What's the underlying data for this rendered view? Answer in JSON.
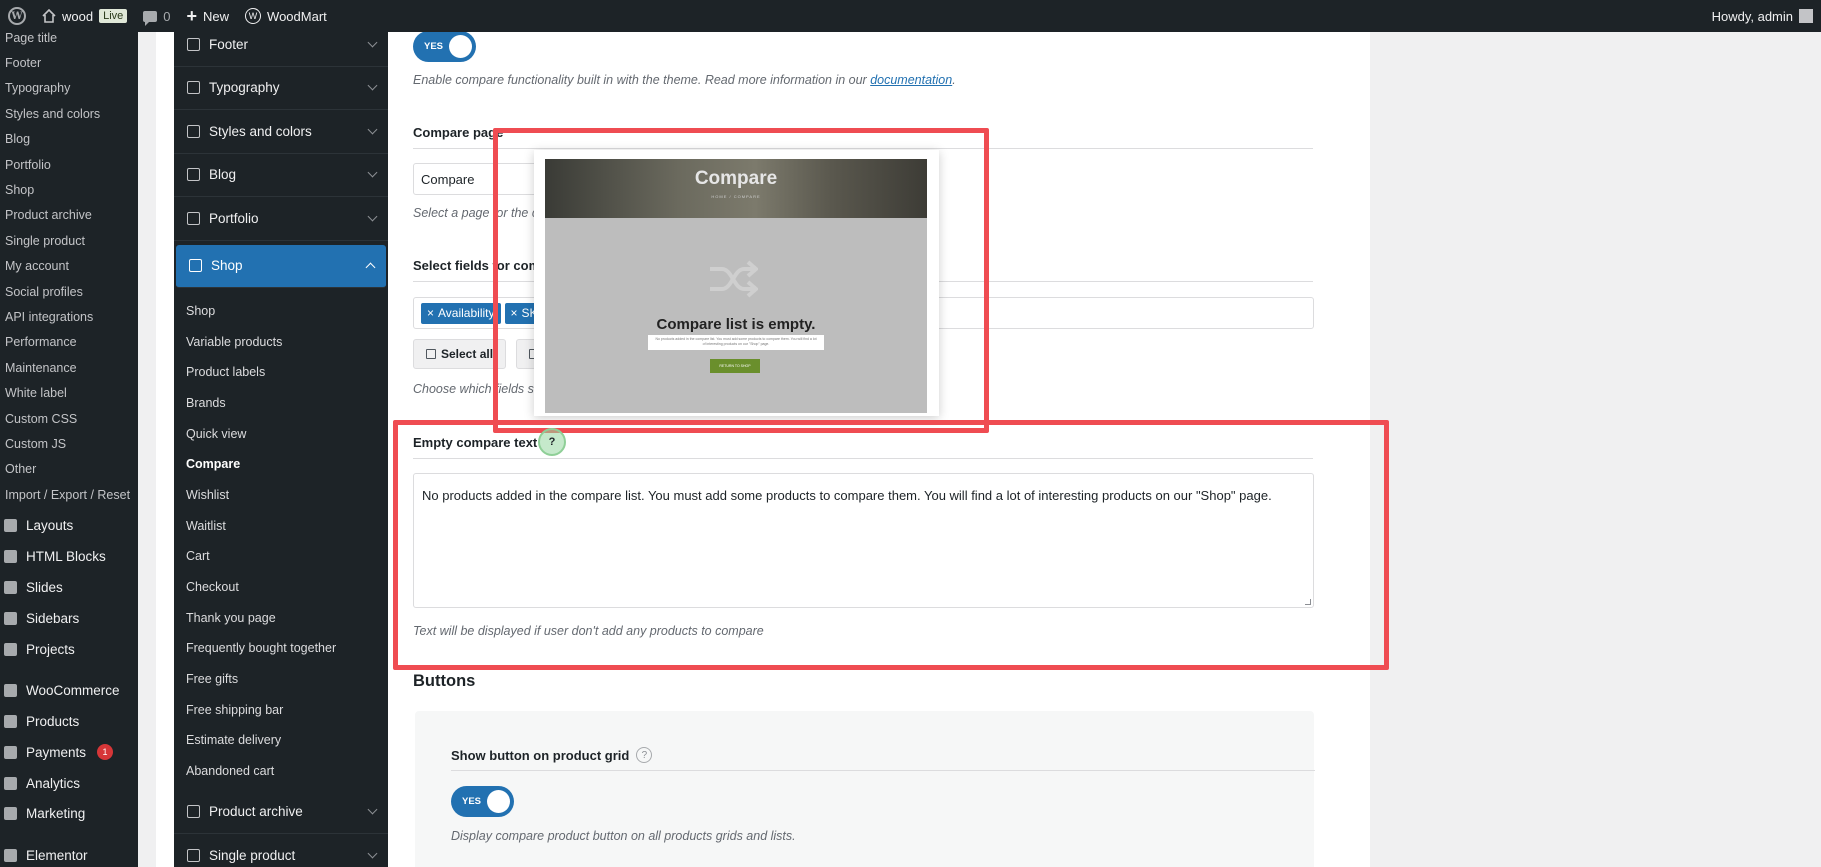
{
  "admin_bar": {
    "site_name": "wood",
    "live_badge": "Live",
    "comments_count": "0",
    "new_label": "New",
    "theme_label": "WoodMart",
    "greeting": "Howdy, admin"
  },
  "admin_menu": {
    "sub_items": [
      "Page title",
      "Footer",
      "Typography",
      "Styles and colors",
      "Blog",
      "Portfolio",
      "Shop",
      "Product archive",
      "Single product",
      "My account",
      "Social profiles",
      "API integrations",
      "Performance",
      "Maintenance",
      "White label",
      "Custom CSS",
      "Custom JS",
      "Other",
      "Import / Export / Reset"
    ],
    "main_items": [
      {
        "label": "Layouts",
        "icon": "layouts-icon"
      },
      {
        "label": "HTML Blocks",
        "icon": "html-blocks-icon"
      },
      {
        "label": "Slides",
        "icon": "slides-icon"
      },
      {
        "label": "Sidebars",
        "icon": "sidebars-icon"
      },
      {
        "label": "Projects",
        "icon": "projects-icon"
      }
    ],
    "main_items_2": [
      {
        "label": "WooCommerce",
        "icon": "woocommerce-icon"
      },
      {
        "label": "Products",
        "icon": "products-icon"
      },
      {
        "label": "Payments",
        "icon": "payments-icon",
        "badge": "1"
      },
      {
        "label": "Analytics",
        "icon": "analytics-icon"
      },
      {
        "label": "Marketing",
        "icon": "marketing-icon"
      }
    ],
    "main_items_3": [
      {
        "label": "Elementor",
        "icon": "elementor-icon"
      }
    ]
  },
  "theme_nav": {
    "sections_top": [
      {
        "label": "Footer",
        "icon": "footer-icon"
      },
      {
        "label": "Typography",
        "icon": "typography-icon"
      },
      {
        "label": "Styles and colors",
        "icon": "styles-icon"
      },
      {
        "label": "Blog",
        "icon": "blog-icon"
      },
      {
        "label": "Portfolio",
        "icon": "portfolio-icon"
      }
    ],
    "active_section": {
      "label": "Shop",
      "icon": "shop-cart-icon"
    },
    "sub_items": [
      "Shop",
      "Variable products",
      "Product labels",
      "Brands",
      "Quick view",
      "Compare",
      "Wishlist",
      "Waitlist",
      "Cart",
      "Checkout",
      "Thank you page",
      "Frequently bought together",
      "Free gifts",
      "Free shipping bar",
      "Estimate delivery",
      "Abandoned cart"
    ],
    "current_sub": "Compare",
    "sections_bottom": [
      {
        "label": "Product archive",
        "icon": "product-archive-icon"
      },
      {
        "label": "Single product",
        "icon": "single-product-icon"
      }
    ]
  },
  "content": {
    "enable_toggle": "YES",
    "enable_desc_prefix": "Enable compare functionality built in with the theme. Read more information in our ",
    "enable_desc_link": "documentation",
    "enable_desc_suffix": ".",
    "compare_page_title": "Compare page",
    "compare_page_value": "Compare",
    "compare_page_desc": "Select a page for the compare table.",
    "fields_title": "Select fields for compare table",
    "field_tags": [
      "Availability",
      "SKU"
    ],
    "select_all_label": "Select all",
    "fields_desc": "Choose which fields should be presented on the product compare page with table.",
    "empty_text_title": "Empty compare text",
    "empty_text_value": "No products added in the compare list. You must add some products to compare them. You will find a lot of interesting products on our \"Shop\" page.",
    "empty_text_desc": "Text will be displayed if user don't add any products to compare",
    "buttons_heading": "Buttons",
    "show_grid_title": "Show button on product grid",
    "show_grid_toggle": "YES",
    "show_grid_desc": "Display compare product button on all products grids and lists."
  },
  "preview": {
    "hero_title": "Compare",
    "hero_crumb": "HOME / COMPARE",
    "empty_title": "Compare list is empty.",
    "empty_body": "No products added in the compare list. You must add some products to compare them. You will find a lot of interesting products on our \"Shop\" page.",
    "return_button": "RETURN TO SHOP"
  },
  "colors": {
    "annotation_red": "#ef4c52",
    "wp_blue": "#2271b1",
    "admin_dark": "#1d2327"
  }
}
